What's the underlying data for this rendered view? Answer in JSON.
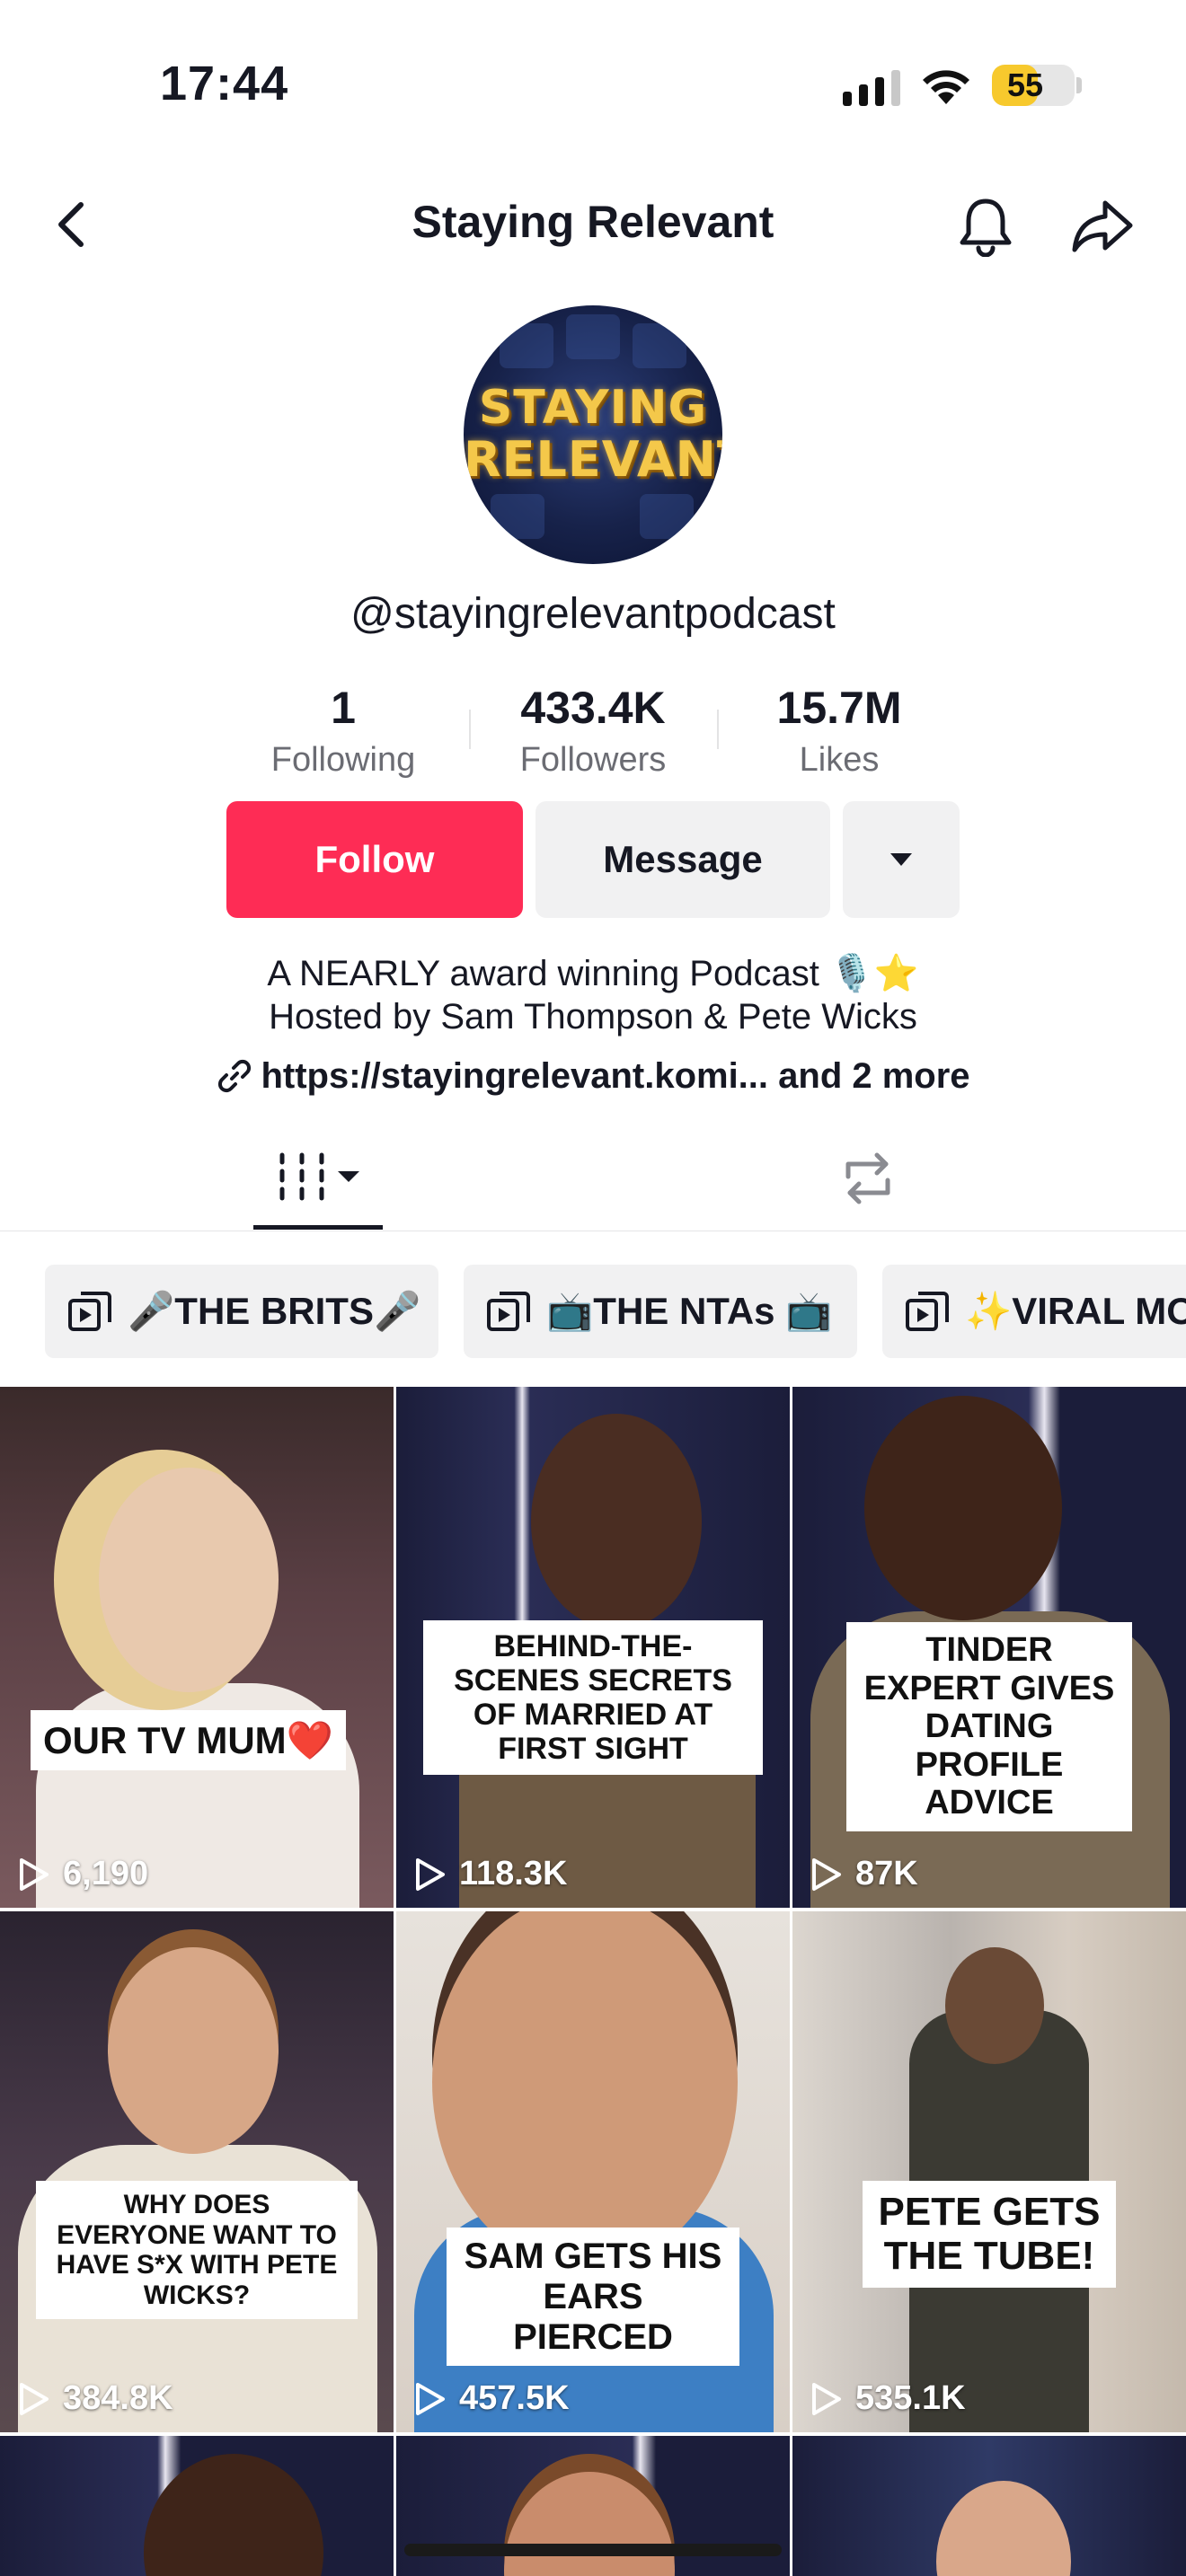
{
  "status_bar": {
    "time": "17:44",
    "battery": "55",
    "battery_level": 0.55
  },
  "nav": {
    "title": "Staying Relevant",
    "icons": [
      "back-arrow-icon",
      "bell-icon",
      "share-icon"
    ]
  },
  "avatar": {
    "line1": "STAYING",
    "line2": "RELEVANT"
  },
  "profile": {
    "handle": "@stayingrelevantpodcast",
    "stats": [
      {
        "value": "1",
        "label": "Following"
      },
      {
        "value": "433.4K",
        "label": "Followers"
      },
      {
        "value": "15.7M",
        "label": "Likes"
      }
    ],
    "buttons": {
      "follow": "Follow",
      "message": "Message"
    },
    "bio_line1": "A NEARLY award winning Podcast 🎙️⭐",
    "bio_line2": "Hosted by Sam Thompson & Pete Wicks",
    "link": "https://stayingrelevant.komi... and 2 more"
  },
  "tabs": [
    "videos-grid-icon",
    "repost-icon"
  ],
  "playlists": [
    {
      "label": "🎤THE BRITS🎤"
    },
    {
      "label": "📺THE NTAs 📺"
    },
    {
      "label": "✨VIRAL MO"
    }
  ],
  "videos": [
    {
      "caption": "OUR TV MUM❤️",
      "views": "6,190"
    },
    {
      "caption": "BEHIND-THE-SCENES SECRETS OF MARRIED AT FIRST SIGHT",
      "views": "118.3K"
    },
    {
      "caption": "TINDER EXPERT GIVES DATING PROFILE ADVICE",
      "views": "87K"
    },
    {
      "caption": "WHY DOES EVERYONE WANT TO HAVE S*X WITH PETE WICKS?",
      "views": "384.8K"
    },
    {
      "caption": "SAM GETS HIS EARS PIERCED",
      "views": "457.5K"
    },
    {
      "caption": "PETE GETS THE TUBE!",
      "views": "535.1K"
    }
  ],
  "colors": {
    "accent": "#fe2c55",
    "text": "#161823",
    "muted": "#6b6c73",
    "chip_bg": "#f1f1f2"
  }
}
